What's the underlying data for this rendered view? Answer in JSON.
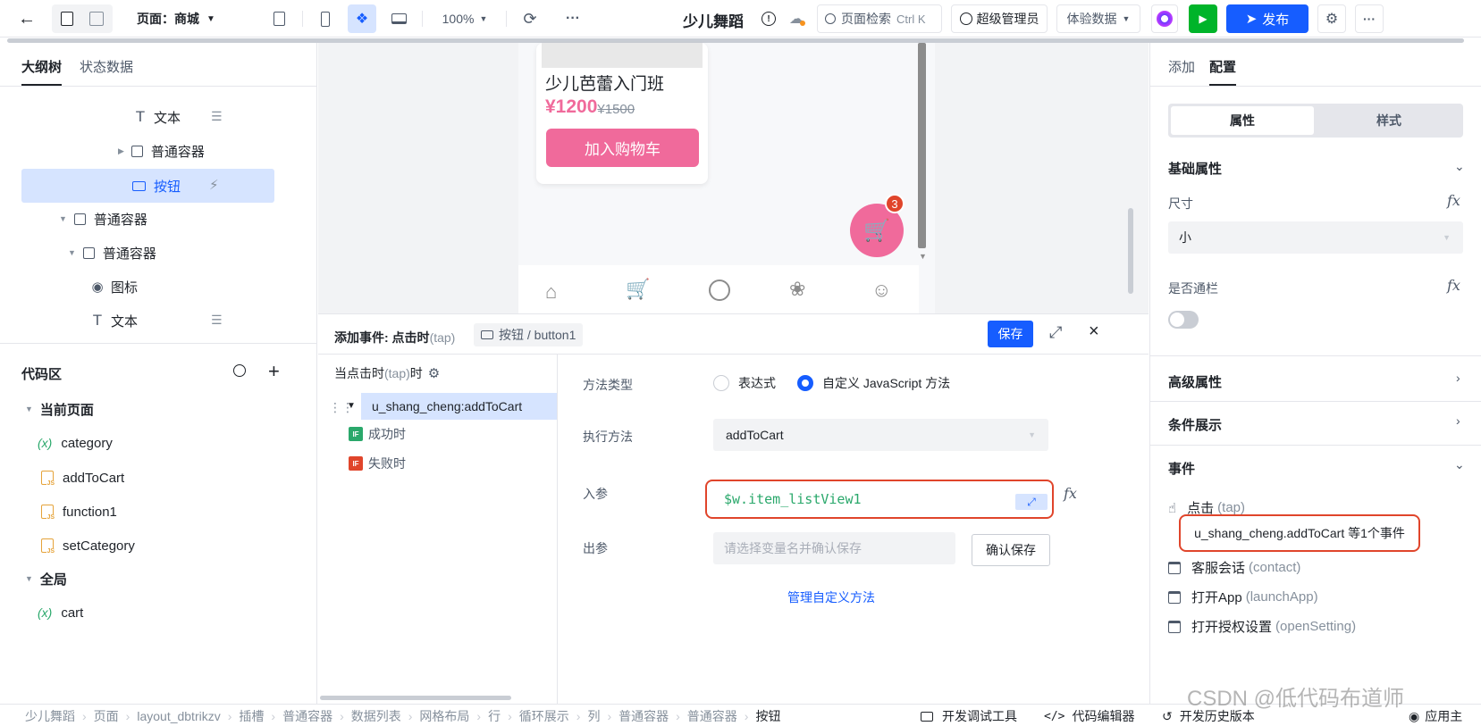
{
  "topbar": {
    "page_label": "页面：商城",
    "zoom": "100%",
    "app_name": "少儿舞蹈",
    "search_placeholder": "页面检索",
    "search_shortcut": "Ctrl K",
    "admin_label": "超级管理员",
    "data_mode": "体验数据",
    "publish_label": "发布",
    "more": "···"
  },
  "left": {
    "tabs": [
      "大纲树",
      "状态数据"
    ],
    "tree": [
      {
        "label": "文本"
      },
      {
        "label": "普通容器"
      },
      {
        "label": "按钮"
      },
      {
        "label": "普通容器"
      },
      {
        "label": "普通容器"
      },
      {
        "label": "图标"
      },
      {
        "label": "文本"
      }
    ],
    "code_title": "代码区",
    "current_page": "当前页面",
    "global": "全局",
    "code_items": [
      "category",
      "addToCart",
      "function1",
      "setCategory"
    ],
    "global_items": [
      "cart"
    ]
  },
  "canvas": {
    "course_title": "少儿芭蕾入门班",
    "price": "¥1200",
    "old_price": "¥1500",
    "cart_button": "加入购物车",
    "badge": "3"
  },
  "event": {
    "title": "添加事件: 点击时",
    "title_sub": "(tap)",
    "component_path": "按钮 / button1",
    "save": "保存",
    "trigger_label": "当点击时",
    "trigger_sub": "(tap)",
    "trigger_suffix": "时",
    "action": "u_shang_cheng:addToCart",
    "success": "成功时",
    "fail": "失败时",
    "if_badge": "IF",
    "method_type_label": "方法类型",
    "radio_expression": "表达式",
    "radio_custom": "自定义 JavaScript 方法",
    "exec_label": "执行方法",
    "exec_value": "addToCart",
    "param_label": "入参",
    "param_value": "$w.item_listView1",
    "out_label": "出参",
    "out_placeholder": "请选择变量名并确认保存",
    "confirm_save": "确认保存",
    "manage_link": "管理自定义方法"
  },
  "right": {
    "tabs": [
      "添加",
      "配置"
    ],
    "segment": [
      "属性",
      "样式"
    ],
    "basic": "基础属性",
    "size_label": "尺寸",
    "size_value": "小",
    "full_label": "是否通栏",
    "advanced": "高级属性",
    "condition": "条件展示",
    "events": "事件",
    "click_label": "点击",
    "click_sub": "(tap)",
    "click_event": "u_shang_cheng.addToCart 等1个事件",
    "other_events": [
      {
        "label": "客服会话",
        "sub": "(contact)"
      },
      {
        "label": "打开App",
        "sub": "(launchApp)"
      },
      {
        "label": "打开授权设置",
        "sub": "(openSetting)"
      }
    ]
  },
  "bottom": {
    "crumbs": [
      "少儿舞蹈",
      "页面",
      "layout_dbtrikzv",
      "插槽",
      "普通容器",
      "数据列表",
      "网格布局",
      "行",
      "循环展示",
      "列",
      "普通容器",
      "普通容器",
      "按钮"
    ],
    "dev_tools": "开发调试工具",
    "code_editor": "代码编辑器",
    "history": "开发历史版本",
    "apply": "应用主",
    "watermark": "CSDN @低代码布道师"
  },
  "colors": {
    "primary": "#165dff",
    "accent_pink": "#f06a9b",
    "highlight": "#d6e4ff",
    "danger_outline": "#e0452b",
    "green": "#2aa86b"
  }
}
